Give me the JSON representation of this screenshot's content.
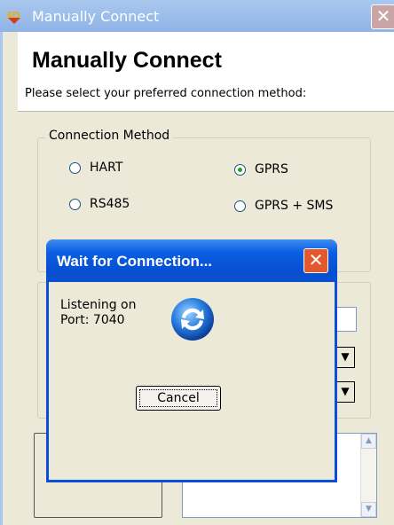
{
  "window": {
    "title": "Manually Connect",
    "close_glyph": "✕"
  },
  "header": {
    "heading": "Manually Connect",
    "subheading": "Please select your preferred connection method:"
  },
  "connection_method": {
    "legend": "Connection Method",
    "options": [
      {
        "label": "HART",
        "selected": false
      },
      {
        "label": "GPRS",
        "selected": true
      },
      {
        "label": "RS485",
        "selected": false
      },
      {
        "label": "GPRS + SMS",
        "selected": false
      }
    ]
  },
  "dialog": {
    "title": "Wait for Connection...",
    "close_glyph": "✕",
    "message": "Listening on\nPort: 7040",
    "cancel_label": "Cancel",
    "icon": "sync-icon"
  },
  "colors": {
    "dialog_title_blue": "#0b5fe2",
    "dialog_close_red": "#e3582d",
    "selected_radio_green": "#21a121"
  }
}
